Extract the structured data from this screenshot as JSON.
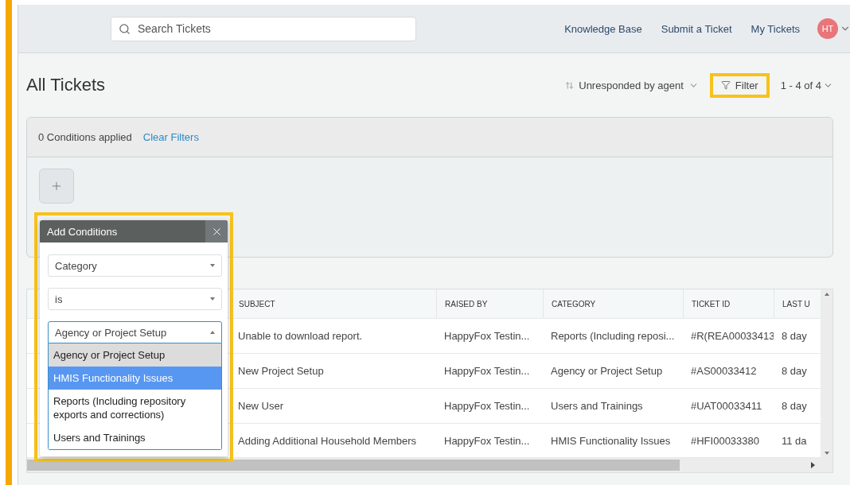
{
  "search": {
    "placeholder": "Search Tickets"
  },
  "nav": [
    "Knowledge Base",
    "Submit a Ticket",
    "My Tickets"
  ],
  "user": {
    "initials": "HT"
  },
  "page_title": "All Tickets",
  "sort": {
    "label": "Unresponded by agent"
  },
  "filter_button": {
    "label": "Filter",
    "highlighted": true
  },
  "pagination": "1 - 4 of 4",
  "filters": {
    "summary": "0 Conditions applied",
    "clear_link": "Clear Filters"
  },
  "add_conditions": {
    "title": "Add Conditions",
    "highlighted": true,
    "field": "Category",
    "operator": "is",
    "value": "Agency or Project Setup",
    "open": true,
    "options": [
      {
        "label": "Agency or Project Setup",
        "selected": true,
        "highlighted": false
      },
      {
        "label": "HMIS Functionality Issues",
        "selected": false,
        "highlighted": true
      },
      {
        "label": "Reports (Including repository exports and corrections)",
        "selected": false,
        "highlighted": false
      },
      {
        "label": "Users and Trainings",
        "selected": false,
        "highlighted": false
      }
    ]
  },
  "table": {
    "columns": [
      "SUBJECT",
      "RAISED BY",
      "CATEGORY",
      "TICKET ID",
      "LAST U"
    ],
    "rows": [
      {
        "cells": [
          "Unable to download report.",
          "HappyFox Testin...",
          "Reports (Including reposi...",
          "#R(REA00033413",
          "8 day"
        ]
      },
      {
        "cells": [
          "New Project Setup",
          "HappyFox Testin...",
          "Agency or Project Setup",
          "#AS00033412",
          "8 day"
        ]
      },
      {
        "cells": [
          "New User",
          "HappyFox Testin...",
          "Users and Trainings",
          "#UAT00033411",
          "8 day"
        ]
      },
      {
        "cells": [
          "Adding Additional Household Members",
          "HappyFox Testin...",
          "HMIS Functionality Issues",
          "#HFI00033380",
          "11 da"
        ]
      }
    ]
  }
}
